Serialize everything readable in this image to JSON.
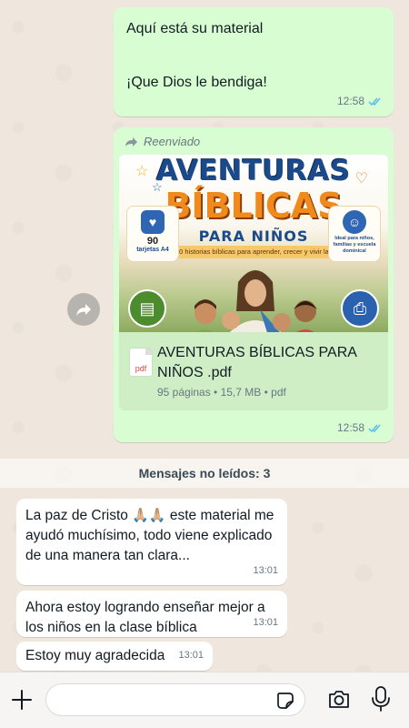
{
  "messages_out": [
    {
      "line1": "Aquí está su material",
      "line2": "¡Que Dios le bendiga!",
      "time": "12:58"
    }
  ],
  "forwarded_label": "Reenviado",
  "document": {
    "cover": {
      "title1": "AVENTURAS",
      "title2": "BÍBLICAS",
      "title3": "PARA NIÑOS",
      "ribbon": "30 historias bíblicas para aprender, crecer y vivir la fe",
      "left_card_count": "90",
      "left_card_text": "tarjetas A4",
      "right_card_text": "Ideal para niños, familias y escuela dominical"
    },
    "name": "AVENTURAS BÍBLICAS PARA NIÑOS .pdf",
    "icon_label": "pdf",
    "info": "95 páginas • 15,7 MB • pdf",
    "time": "12:58"
  },
  "unread_label": "Mensajes no leídos: 3",
  "messages_in": [
    {
      "text_before": "La paz de Cristo ",
      "emoji": "🙏🏼🙏🏼",
      "text_after": " este material me ayudó muchísimo, todo viene explicado de una manera tan clara...",
      "time": "13:01"
    },
    {
      "text": "Ahora estoy logrando enseñar mejor a los niños en la clase bíblica",
      "time": "13:01"
    },
    {
      "text": "Estoy muy agradecida",
      "time": "13:01"
    }
  ],
  "colors": {
    "outgoing_bubble": "#d9fdd3",
    "incoming_bubble": "#ffffff",
    "read_ticks": "#53bdeb"
  },
  "icons": [
    "double-check-icon",
    "forward-arrow-icon",
    "pdf-icon",
    "plus-icon",
    "sticker-icon",
    "camera-icon",
    "mic-icon"
  ]
}
